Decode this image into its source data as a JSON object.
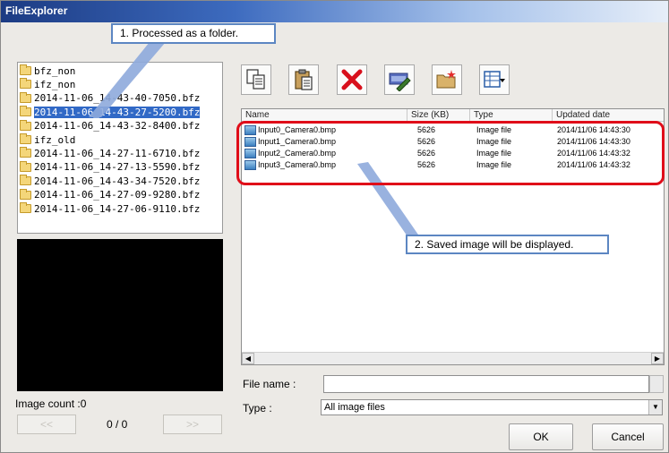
{
  "window": {
    "title": "FileExplorer"
  },
  "folders": [
    {
      "name": "bfz_non",
      "selected": false
    },
    {
      "name": "ifz_non",
      "selected": false
    },
    {
      "name": "2014-11-06_14-43-40-7050.bfz",
      "selected": false
    },
    {
      "name": "2014-11-06_14-43-27-5200.bfz",
      "selected": true
    },
    {
      "name": "2014-11-06_14-43-32-8400.bfz",
      "selected": false
    },
    {
      "name": "ifz_old",
      "selected": false
    },
    {
      "name": "2014-11-06_14-27-11-6710.bfz",
      "selected": false
    },
    {
      "name": "2014-11-06_14-27-13-5590.bfz",
      "selected": false
    },
    {
      "name": "2014-11-06_14-43-34-7520.bfz",
      "selected": false
    },
    {
      "name": "2014-11-06_14-27-09-9280.bfz",
      "selected": false
    },
    {
      "name": "2014-11-06_14-27-06-9110.bfz",
      "selected": false
    }
  ],
  "left_panel": {
    "image_count": "Image count :0",
    "page_counter": "0 / 0",
    "prev_label": "<<",
    "next_label": ">>"
  },
  "toolbar": {
    "buttons": [
      "copy-icon",
      "paste-icon",
      "delete-icon",
      "rename-icon",
      "new-folder-icon",
      "view-options-icon"
    ]
  },
  "file_list": {
    "columns": [
      "Name",
      "Size (KB)",
      "Type",
      "Updated date"
    ],
    "rows": [
      {
        "name": "Input0_Camera0.bmp",
        "size": "5626",
        "type": "Image file",
        "date": "2014/11/06 14:43:30"
      },
      {
        "name": "Input1_Camera0.bmp",
        "size": "5626",
        "type": "Image file",
        "date": "2014/11/06 14:43:30"
      },
      {
        "name": "Input2_Camera0.bmp",
        "size": "5626",
        "type": "Image file",
        "date": "2014/11/06 14:43:32"
      },
      {
        "name": "Input3_Camera0.bmp",
        "size": "5626",
        "type": "Image file",
        "date": "2014/11/06 14:43:32"
      }
    ]
  },
  "form": {
    "file_name_label": "File name :",
    "file_name_value": "",
    "type_label": "Type :",
    "type_value": "All image files",
    "ok_label": "OK",
    "cancel_label": "Cancel"
  },
  "annotations": {
    "callout1": "1. Processed as a folder.",
    "callout2": "2. Saved image will be displayed."
  },
  "colors": {
    "selection": "#3169c6",
    "highlight_frame": "#e00d19",
    "callout_border": "#5c86c2",
    "title_bar": "#1c3b83"
  }
}
